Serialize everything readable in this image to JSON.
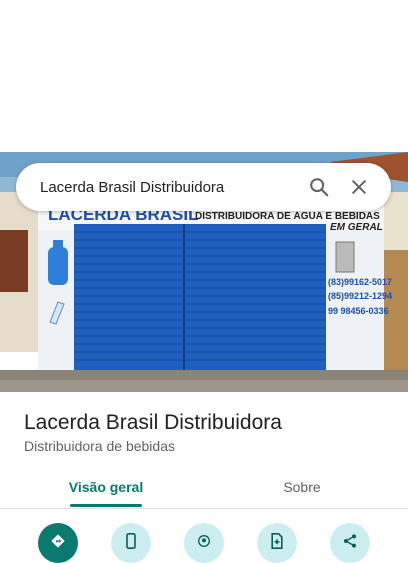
{
  "search": {
    "query": "Lacerda Brasil Distribuidora"
  },
  "photo": {
    "sign_name": "LACERDA BRASIL",
    "sign_subtitle": "DISTRIBUIDORA DE ÁGUA E BEBIDAS",
    "sign_subtitle2": "EM GERAL",
    "phones": [
      "(83)99162-5017",
      "(85)99212-1294",
      "99 98456-0336"
    ]
  },
  "place": {
    "name": "Lacerda Brasil Distribuidora",
    "category": "Distribuidora de bebidas"
  },
  "tabs": [
    {
      "label": "Visão geral"
    },
    {
      "label": "Sobre"
    }
  ],
  "actions": [
    {
      "icon": "directions-icon"
    },
    {
      "icon": "phone-icon"
    },
    {
      "icon": "location-icon"
    },
    {
      "icon": "add-photo-icon"
    },
    {
      "icon": "share-icon"
    }
  ],
  "colors": {
    "accent": "#0b7a6e",
    "action_bg": "#cdeef0",
    "shutter_blue": "#1f5fbf"
  }
}
